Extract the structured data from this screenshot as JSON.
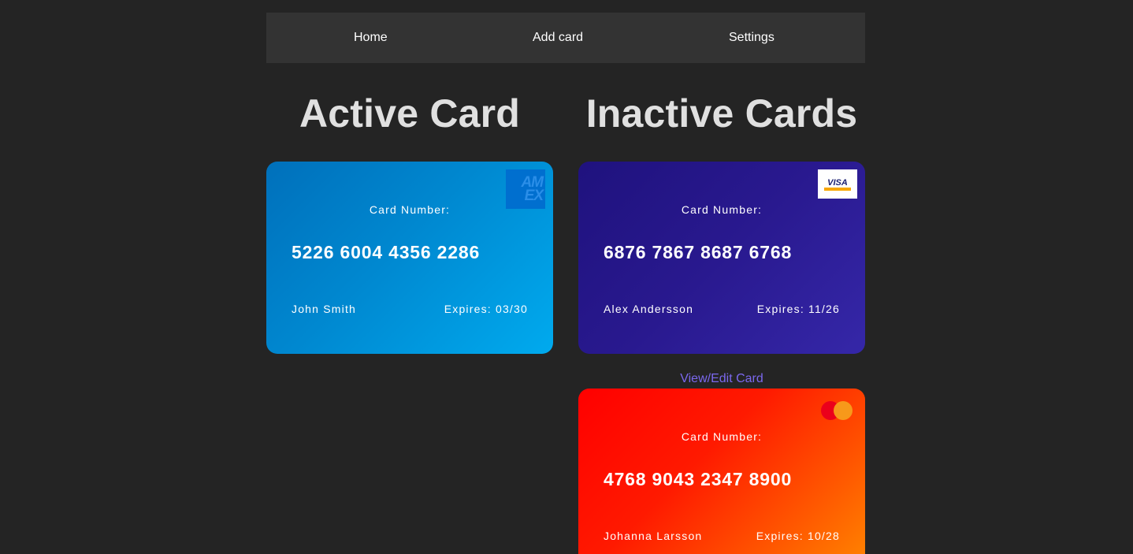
{
  "nav": {
    "home": "Home",
    "add_card": "Add card",
    "settings": "Settings"
  },
  "sections": {
    "active_title": "Active Card",
    "inactive_title": "Inactive Cards"
  },
  "active_card": {
    "brand": "amex-logo-icon",
    "brand_text": "AM EX",
    "label": "Card Number:",
    "number": "5226 6004 4356 2286",
    "holder": "John Smith",
    "expires": "Expires: 03/30",
    "colors": [
      "#0070bb",
      "#00aaee"
    ]
  },
  "inactive_cards": [
    {
      "brand": "visa-logo-icon",
      "brand_text": "VISA",
      "label": "Card Number:",
      "number": "6876 7867 8687 6768",
      "holder": "Alex Andersson",
      "expires": "Expires: 11/26",
      "colors": [
        "#1f127e",
        "#3527a8"
      ]
    },
    {
      "brand": "mastercard-logo-icon",
      "label": "Card Number:",
      "number": "4768 9043 2347 8900",
      "holder": "Johanna Larsson",
      "expires": "Expires: 10/28",
      "colors": [
        "#ff0000",
        "#ff8a00"
      ]
    }
  ],
  "view_edit_label": "View/Edit Card",
  "accent_link_color": "#7b68ee"
}
